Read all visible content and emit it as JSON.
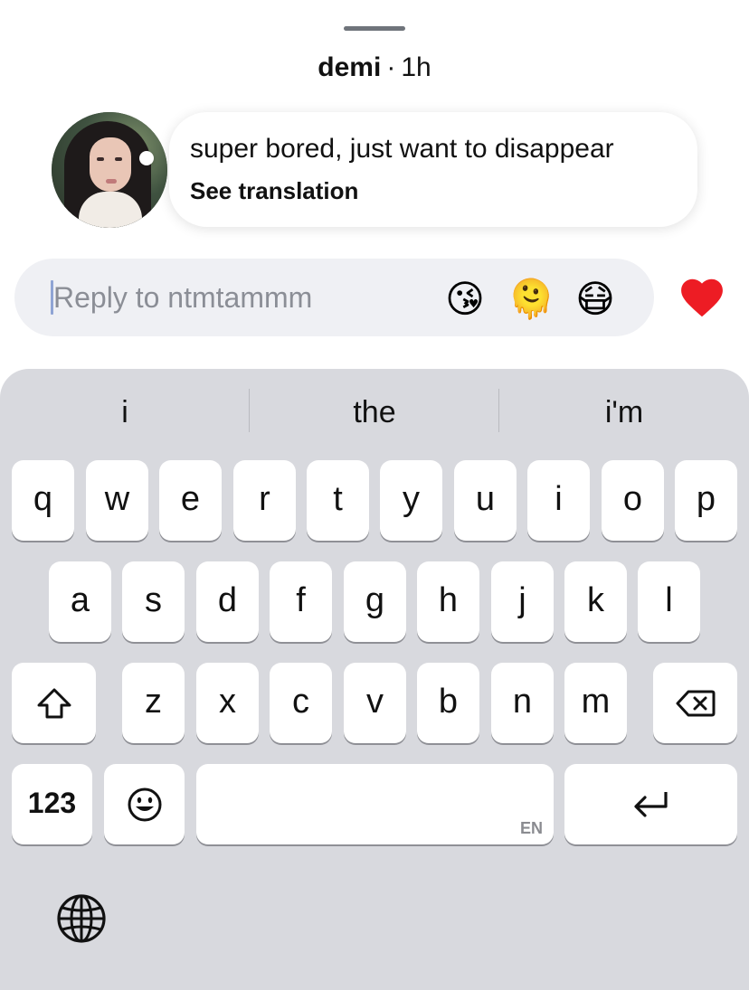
{
  "header": {
    "username": "demi",
    "separator": "·",
    "time": "1h"
  },
  "story_reply": {
    "message": "super bored, just want to disappear",
    "translation_link": "See translation"
  },
  "reply_bar": {
    "placeholder": "Reply to ntmtammm",
    "quick_reactions": [
      "😘",
      "🫠",
      "😷"
    ],
    "heart_color": "#ed1c24"
  },
  "keyboard": {
    "suggestions": [
      "i",
      "the",
      "i'm"
    ],
    "row1": [
      "q",
      "w",
      "e",
      "r",
      "t",
      "y",
      "u",
      "i",
      "o",
      "p"
    ],
    "row2": [
      "a",
      "s",
      "d",
      "f",
      "g",
      "h",
      "j",
      "k",
      "l"
    ],
    "row3": [
      "z",
      "x",
      "c",
      "v",
      "b",
      "n",
      "m"
    ],
    "numbers_label": "123",
    "space_lang": "EN"
  }
}
